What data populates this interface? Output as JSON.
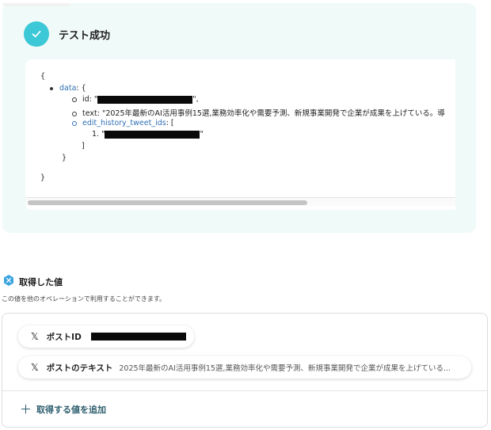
{
  "test_result": {
    "title": "テスト成功"
  },
  "json_output": {
    "open_brace": "{",
    "close_brace": "}",
    "data_key": "data",
    "data_open": ": {",
    "id_label": "id: \"",
    "id_suffix": "\",",
    "text_label": "text: \"2025年最新のAI活用事例15選,業務効率化や需要予測、新規事業開発で企業が成果を上げている。導",
    "history_key": "edit_history_tweet_ids",
    "history_open": ": [",
    "history_item_prefix": "1. \"",
    "history_item_suffix": "\"",
    "history_close": "]",
    "data_close": "}"
  },
  "acquired_values": {
    "title": "取得した値",
    "description": "この値を他のオペレーションで利用することができます。",
    "items": [
      {
        "label": "ポストID",
        "value": ""
      },
      {
        "label": "ポストのテキスト",
        "value": "2025年最新のAI活用事例15選,業務効率化や需要予測、新規事業開発で企業が成果を上げている..."
      }
    ],
    "add_button": "取得する値を追加"
  },
  "colors": {
    "accent": "#3cc8d6",
    "panel_bg": "#f0faf9",
    "key_color": "#2f6fb5",
    "add_color": "#2f5f6f"
  },
  "icons": {
    "check": "check-icon",
    "x_logo": "x-logo-icon",
    "badge": "hexagon-x-icon",
    "plus": "plus-icon"
  }
}
